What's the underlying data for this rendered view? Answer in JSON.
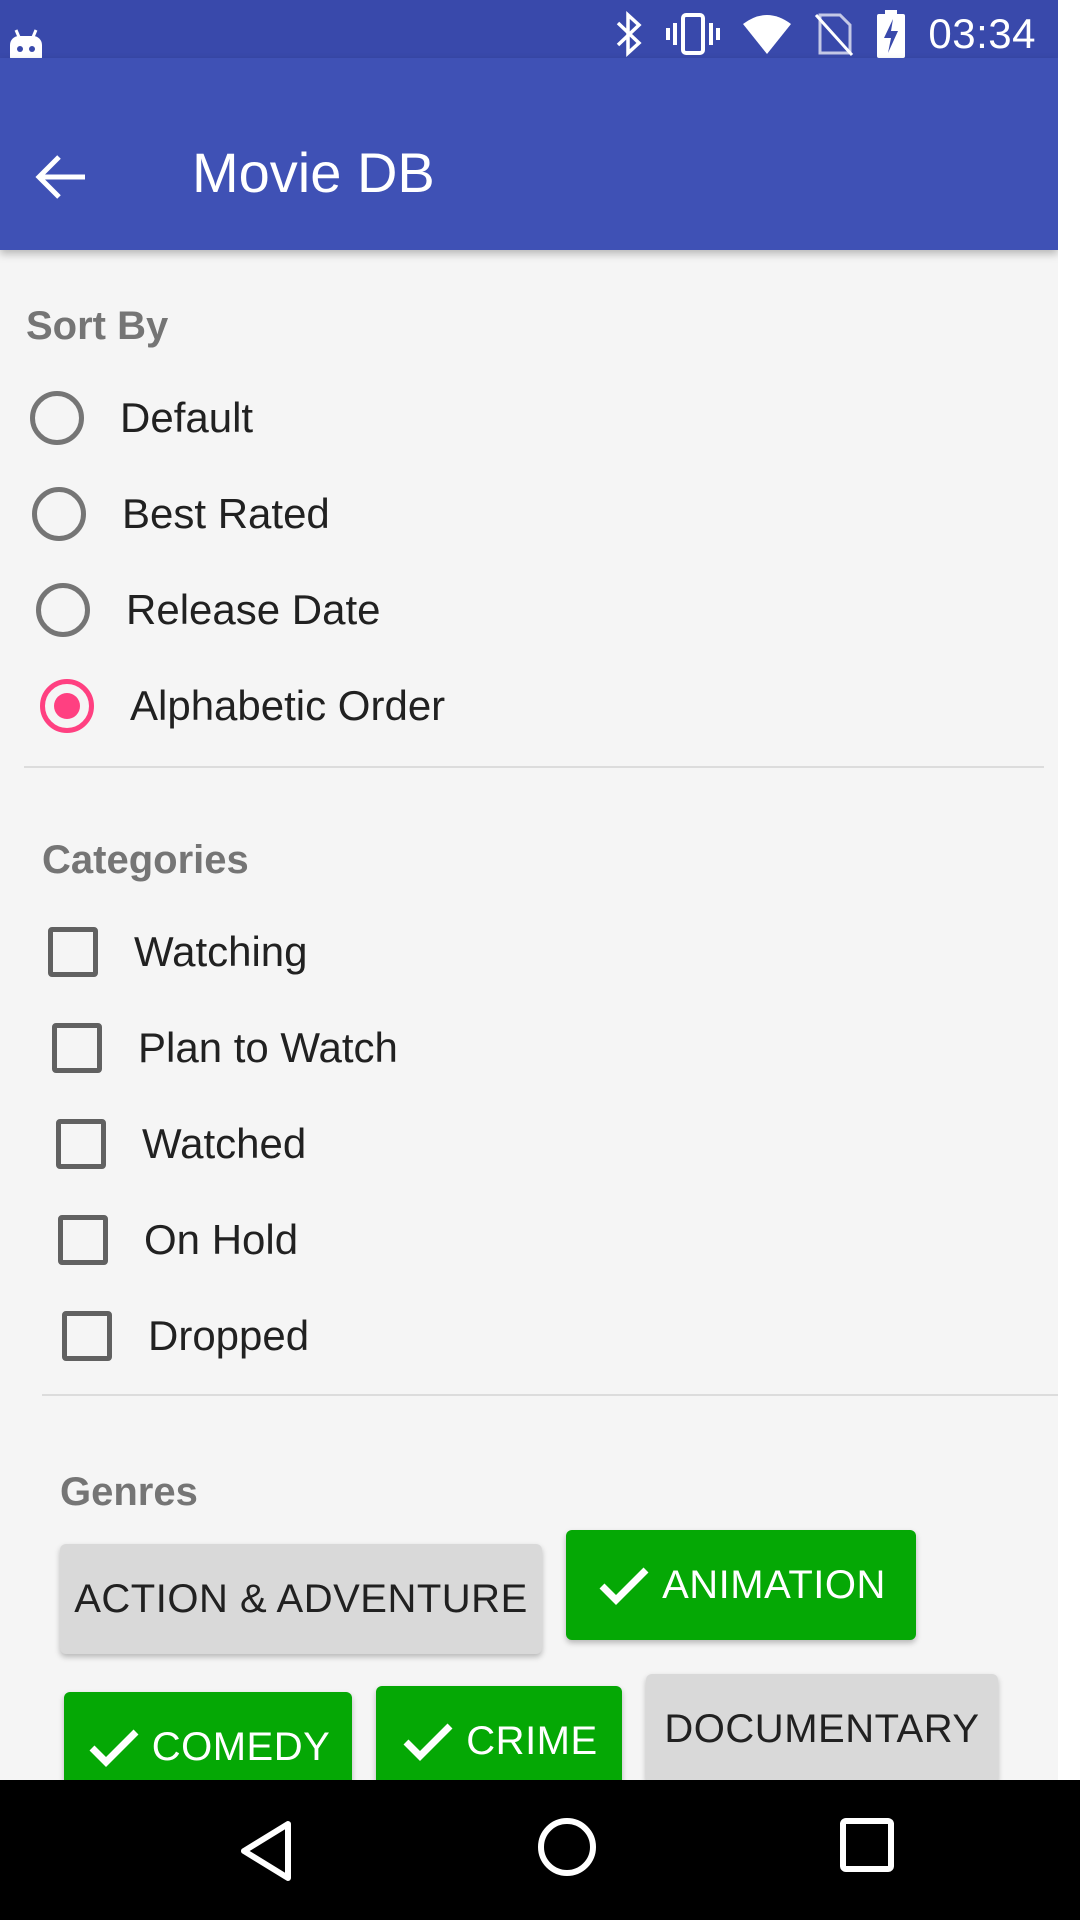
{
  "status_bar": {
    "time": "03:34",
    "icons": [
      "android-icon",
      "bluetooth-icon",
      "vibrate-icon",
      "wifi-icon",
      "no-sim-icon",
      "battery-charging-icon"
    ]
  },
  "app_bar": {
    "title": "Movie DB",
    "back_icon": "arrow-left-icon"
  },
  "sort_by": {
    "title": "Sort By",
    "selected": "Alphabetic Order",
    "options": [
      {
        "label": "Default",
        "checked": false
      },
      {
        "label": "Best Rated",
        "checked": false
      },
      {
        "label": "Release Date",
        "checked": false
      },
      {
        "label": "Alphabetic Order",
        "checked": true
      }
    ]
  },
  "categories": {
    "title": "Categories",
    "items": [
      {
        "label": "Watching",
        "checked": false
      },
      {
        "label": "Plan to Watch",
        "checked": false
      },
      {
        "label": "Watched",
        "checked": false
      },
      {
        "label": "On Hold",
        "checked": false
      },
      {
        "label": "Dropped",
        "checked": false
      }
    ]
  },
  "genres": {
    "title": "Genres",
    "chips": [
      {
        "label": "ACTION & ADVENTURE",
        "selected": false
      },
      {
        "label": "ANIMATION",
        "selected": true
      },
      {
        "label": "COMEDY",
        "selected": true
      },
      {
        "label": "CRIME",
        "selected": true
      },
      {
        "label": "DOCUMENTARY",
        "selected": false
      }
    ]
  },
  "colors": {
    "primary": "#3f51b5",
    "primary_dark": "#3949ab",
    "accent": "#ff4081",
    "chip_selected": "#05a805",
    "chip_unselected": "#d9d9d9"
  },
  "nav_bar": {
    "icons": [
      "back-triangle-icon",
      "home-circle-icon",
      "recents-square-icon"
    ]
  }
}
